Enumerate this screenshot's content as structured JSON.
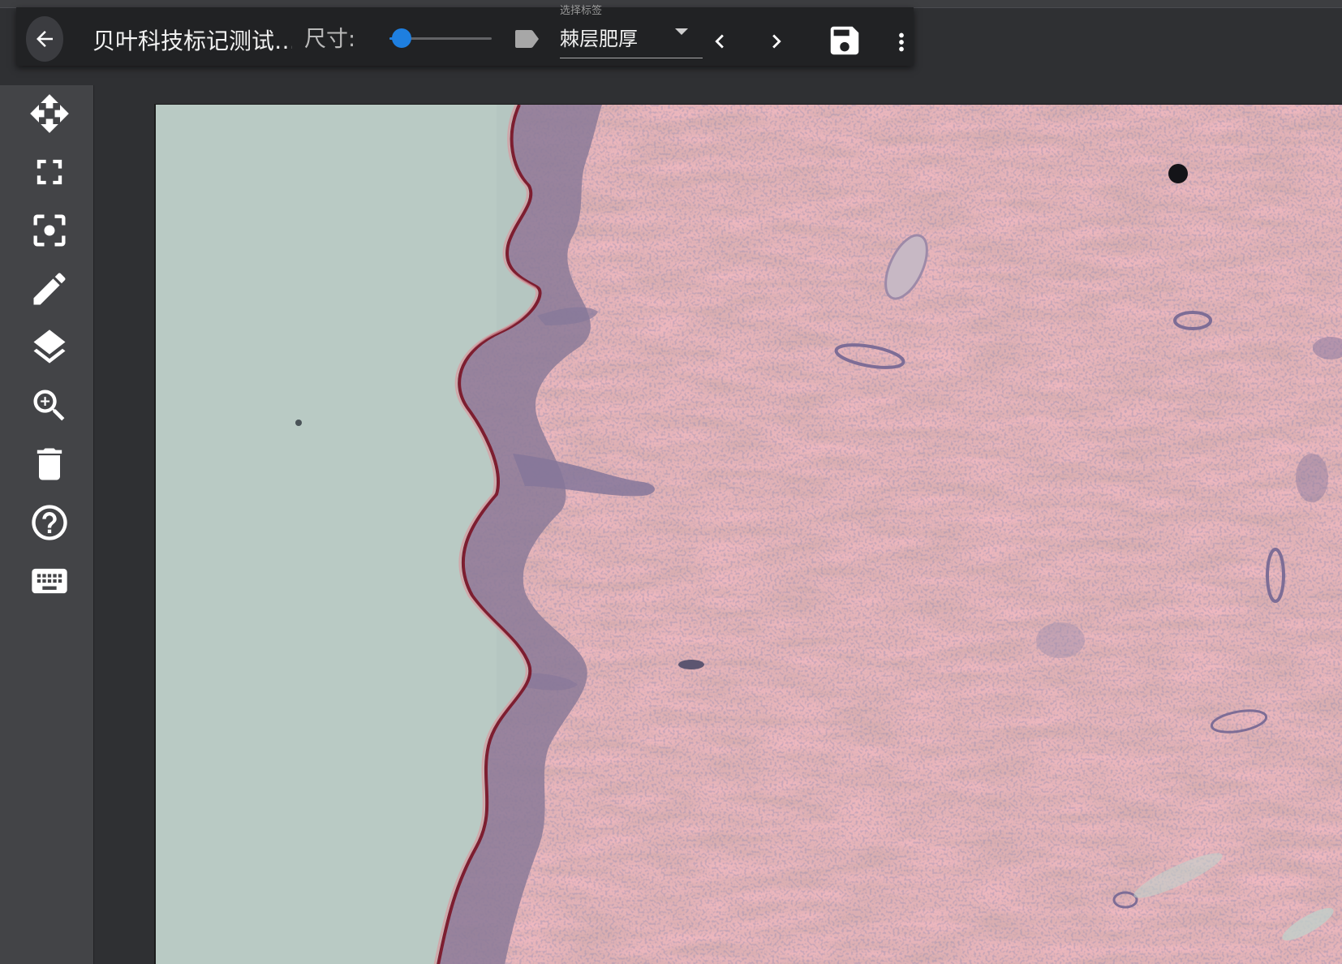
{
  "toolbar": {
    "title": "贝叶科技标记测试…",
    "size_label": "尺寸:",
    "size_slider_value": 0.12,
    "label_select": {
      "float_label": "选择标签",
      "value": "棘层肥厚"
    }
  },
  "colors": {
    "accent": "#1e7fe0",
    "toolbar_bg": "#212224",
    "sidebar_bg": "#434447",
    "canvas_bg": "#2f3033",
    "icon": "#ffffff"
  },
  "icons": {
    "back": "arrow-left-icon",
    "label": "label-tag-icon",
    "prev": "chevron-left-icon",
    "next": "chevron-right-icon",
    "save": "save-floppy-icon",
    "more": "more-vertical-icon"
  },
  "sidebar": {
    "tools": [
      {
        "icon": "move-arrows-icon"
      },
      {
        "icon": "fullscreen-icon"
      },
      {
        "icon": "center-focus-icon"
      },
      {
        "icon": "pencil-icon"
      },
      {
        "icon": "layers-icon"
      },
      {
        "icon": "zoom-in-icon"
      },
      {
        "icon": "trash-icon"
      },
      {
        "icon": "help-circle-icon"
      },
      {
        "icon": "keyboard-icon"
      }
    ]
  }
}
